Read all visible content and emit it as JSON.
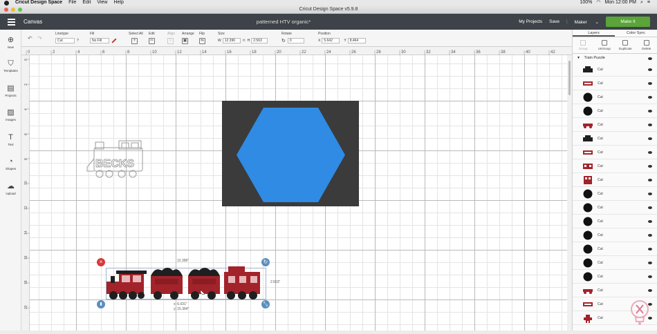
{
  "menubar": {
    "app": "Cricut Design Space",
    "items": [
      "File",
      "Edit",
      "View",
      "Help"
    ],
    "battery": "100%",
    "clock": "Mon 12:00 PM"
  },
  "window": {
    "title": "Cricut Design Space v5.9.8"
  },
  "topbar": {
    "section": "Canvas",
    "project_title": "patterned HTV organic*",
    "my_projects": "My Projects",
    "save": "Save",
    "machine": "Maker",
    "make_it": "Make It"
  },
  "toolbar": {
    "linetype_label": "Linetype",
    "linetype_value": "Cut",
    "fill_label": "Fill",
    "fill_value": "No Fill",
    "selectall_label": "Select All",
    "edit_label": "Edit",
    "align_label": "Align",
    "arrange_label": "Arrange",
    "flip_label": "Flip",
    "size_label": "Size",
    "w_label": "W",
    "w_value": "12.396",
    "h_label": "H",
    "h_value": "2.563",
    "rotate_label": "Rotate",
    "rotate_value": "0",
    "position_label": "Position",
    "x_label": "X",
    "x_value": "5.642",
    "y_label": "Y",
    "y_value": "8.464"
  },
  "leftbar": {
    "items": [
      {
        "label": "New",
        "icon": "plus-circle-icon"
      },
      {
        "label": "Templates",
        "icon": "shirt-icon"
      },
      {
        "label": "Projects",
        "icon": "projects-icon"
      },
      {
        "label": "Images",
        "icon": "image-icon"
      },
      {
        "label": "Text",
        "icon": "text-icon"
      },
      {
        "label": "Shapes",
        "icon": "shapes-icon"
      },
      {
        "label": "Upload",
        "icon": "upload-icon"
      }
    ]
  },
  "ruler": {
    "top": [
      "0",
      "2",
      "4",
      "6",
      "8",
      "10",
      "12",
      "14",
      "16",
      "18",
      "20",
      "22",
      "24",
      "26",
      "28",
      "30",
      "32",
      "34",
      "36",
      "38",
      "40",
      "42"
    ],
    "left": [
      "0",
      "2",
      "4",
      "6",
      "8",
      "10",
      "12",
      "14",
      "16",
      "18",
      "20"
    ]
  },
  "canvas": {
    "hexagon_color": "#2f8be4",
    "background_rect_color": "#3b3b3b",
    "becks_text": "BECKS",
    "selection": {
      "width_label": "12.396\"",
      "height_label": "2.563\"",
      "x_label": "x: 6.031\"",
      "y_label": "y: 15.364\""
    },
    "train_color": "#a3232b",
    "coal_color": "#1f1f1f"
  },
  "layers": {
    "tabs": [
      "Layers",
      "Color Sync"
    ],
    "actions": [
      "Group",
      "UnGroup",
      "Duplicate",
      "Delete"
    ],
    "group_name": "Train Puzzle",
    "rows": [
      {
        "label": "Cut",
        "thumb": "black-train"
      },
      {
        "label": "Cut",
        "thumb": "red-strip"
      },
      {
        "label": "Cut",
        "thumb": "black-circle"
      },
      {
        "label": "Cut",
        "thumb": "black-circle"
      },
      {
        "label": "Cut",
        "thumb": "red-wheels"
      },
      {
        "label": "Cut",
        "thumb": "black-train"
      },
      {
        "label": "Cut",
        "thumb": "red-strip"
      },
      {
        "label": "Cut",
        "thumb": "red-car"
      },
      {
        "label": "Cut",
        "thumb": "red-caboose"
      },
      {
        "label": "Cut",
        "thumb": "black-circle"
      },
      {
        "label": "Cut",
        "thumb": "black-circle"
      },
      {
        "label": "Cut",
        "thumb": "black-circle"
      },
      {
        "label": "Cut",
        "thumb": "black-circle"
      },
      {
        "label": "Cut",
        "thumb": "black-circle"
      },
      {
        "label": "Cut",
        "thumb": "black-circle"
      },
      {
        "label": "Cut",
        "thumb": "black-circle"
      },
      {
        "label": "Cut",
        "thumb": "red-wheels"
      },
      {
        "label": "Cut",
        "thumb": "red-strip"
      },
      {
        "label": "Cut",
        "thumb": "red-figure"
      }
    ]
  }
}
